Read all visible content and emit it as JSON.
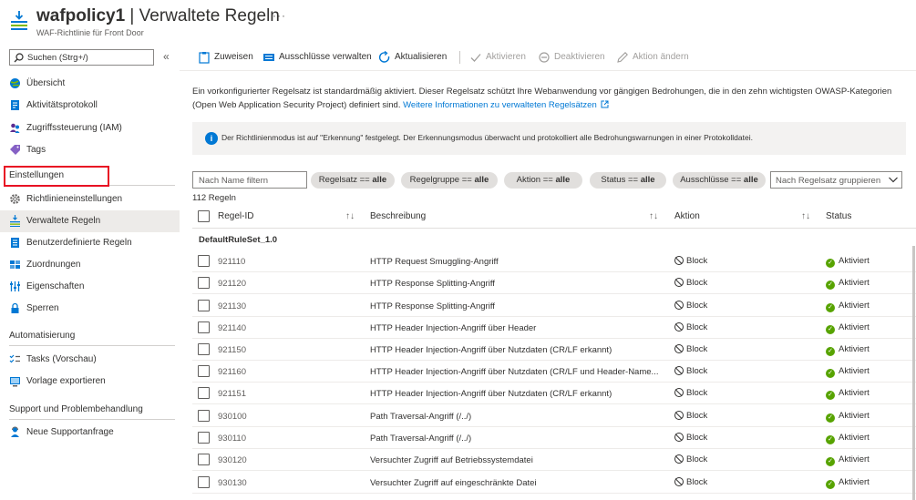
{
  "header": {
    "resource_name": "wafpolicy1",
    "separator": " | ",
    "page_title": "Verwaltete Regeln",
    "more_label": "···",
    "subtitle": "WAF-Richtlinie für Front Door"
  },
  "sidebar": {
    "search_placeholder": "Suchen (Strg+/)",
    "collapse_label": "«",
    "items_top": [
      {
        "label": "Übersicht",
        "icon": "globe-icon"
      },
      {
        "label": "Aktivitätsprotokoll",
        "icon": "activity-log-icon"
      },
      {
        "label": "Zugriffssteuerung (IAM)",
        "icon": "iam-people-icon"
      },
      {
        "label": "Tags",
        "icon": "tag-icon"
      }
    ],
    "section_settings": "Einstellungen",
    "items_settings": [
      {
        "label": "Richtlinieneinstellungen",
        "icon": "gear-icon"
      },
      {
        "label": "Verwaltete Regeln",
        "icon": "managed-rules-icon",
        "active": true
      },
      {
        "label": "Benutzerdefinierte Regeln",
        "icon": "custom-rules-icon"
      },
      {
        "label": "Zuordnungen",
        "icon": "associations-icon"
      },
      {
        "label": "Eigenschaften",
        "icon": "properties-icon"
      },
      {
        "label": "Sperren",
        "icon": "lock-icon"
      }
    ],
    "section_automation": "Automatisierung",
    "items_automation": [
      {
        "label": "Tasks (Vorschau)",
        "icon": "tasks-icon"
      },
      {
        "label": "Vorlage exportieren",
        "icon": "export-template-icon"
      }
    ],
    "section_support": "Support und Problembehandlung",
    "items_support": [
      {
        "label": "Neue Supportanfrage",
        "icon": "support-person-icon"
      }
    ]
  },
  "toolbar": {
    "assign": "Zuweisen",
    "exclusions": "Ausschlüsse verwalten",
    "refresh": "Aktualisieren",
    "enable": "Aktivieren",
    "disable": "Deaktivieren",
    "change_action": "Aktion ändern"
  },
  "description": {
    "text": "Ein vorkonfigurierter Regelsatz ist standardmäßig aktiviert. Dieser Regelsatz schützt Ihre Webanwendung vor gängigen Bedrohungen, die in den zehn wichtigsten OWASP-Kategorien (Open Web Application Security Project) definiert sind.",
    "link": "Weitere Informationen zu verwalteten Regelsätzen"
  },
  "info": {
    "icon_glyph": "i",
    "text": "Der Richtlinienmodus ist auf \"Erkennung\" festgelegt. Der Erkennungsmodus überwacht und protokolliert alle Bedrohungswarnungen in einer Protokolldatei."
  },
  "filters": {
    "name_placeholder": "Nach Name filtern",
    "pills": [
      {
        "key": "Regelsatz == ",
        "value": "alle"
      },
      {
        "key": "Regelgruppe == ",
        "value": "alle"
      },
      {
        "key": "Aktion == ",
        "value": "alle"
      },
      {
        "key": "Status == ",
        "value": "alle"
      },
      {
        "key": "Ausschlüsse == ",
        "value": "alle"
      }
    ],
    "group_by": "Nach Regelsatz gruppieren"
  },
  "table": {
    "count": "112 Regeln",
    "columns": {
      "id": "Regel-ID",
      "desc": "Beschreibung",
      "action": "Aktion",
      "status": "Status"
    },
    "sort_glyph": "↑↓",
    "group": "DefaultRuleSet_1.0",
    "rows": [
      {
        "id": "921110",
        "desc": "HTTP Request Smuggling-Angriff",
        "action": "Block",
        "status": "Aktiviert"
      },
      {
        "id": "921120",
        "desc": "HTTP Response Splitting-Angriff",
        "action": "Block",
        "status": "Aktiviert"
      },
      {
        "id": "921130",
        "desc": "HTTP Response Splitting-Angriff",
        "action": "Block",
        "status": "Aktiviert"
      },
      {
        "id": "921140",
        "desc": "HTTP Header Injection-Angriff über Header",
        "action": "Block",
        "status": "Aktiviert"
      },
      {
        "id": "921150",
        "desc": "HTTP Header Injection-Angriff über Nutzdaten (CR/LF erkannt)",
        "action": "Block",
        "status": "Aktiviert"
      },
      {
        "id": "921160",
        "desc": "HTTP Header Injection-Angriff über Nutzdaten (CR/LF und Header-Name...",
        "action": "Block",
        "status": "Aktiviert"
      },
      {
        "id": "921151",
        "desc": "HTTP Header Injection-Angriff über Nutzdaten (CR/LF erkannt)",
        "action": "Block",
        "status": "Aktiviert"
      },
      {
        "id": "930100",
        "desc": "Path Traversal-Angriff (/../)",
        "action": "Block",
        "status": "Aktiviert"
      },
      {
        "id": "930110",
        "desc": "Path Traversal-Angriff (/../)",
        "action": "Block",
        "status": "Aktiviert"
      },
      {
        "id": "930120",
        "desc": "Versuchter Zugriff auf Betriebssystemdatei",
        "action": "Block",
        "status": "Aktiviert"
      },
      {
        "id": "930130",
        "desc": "Versuchter Zugriff auf eingeschränkte Datei",
        "action": "Block",
        "status": "Aktiviert"
      }
    ]
  },
  "colors": {
    "accent": "#0078d4",
    "active_outline": "#e81123",
    "status_ok": "#57a300"
  }
}
